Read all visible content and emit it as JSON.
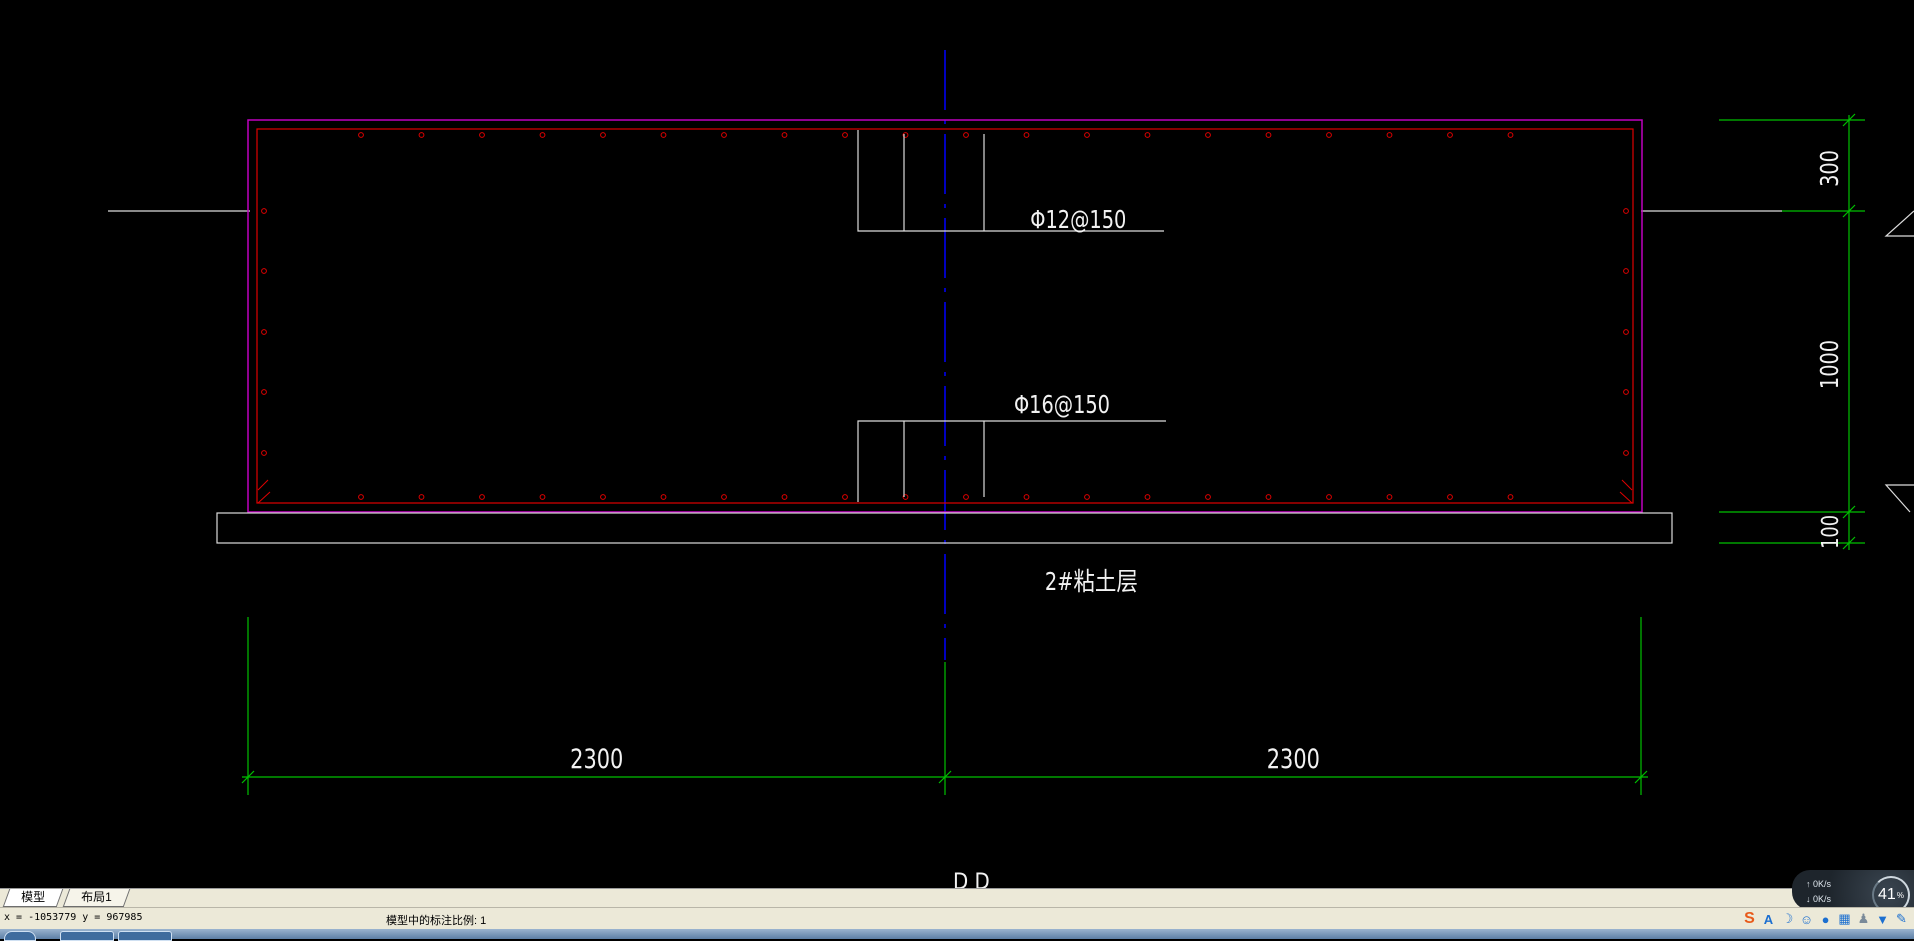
{
  "drawing": {
    "labels": {
      "top_rebar": "Φ12@150",
      "bottom_rebar": "Φ16@150",
      "layer": "2#粘土层",
      "dim_left": "2300",
      "dim_right": "2300",
      "dim_v_top": "300",
      "dim_v_mid": "1000",
      "dim_v_bottom": "100",
      "section_partial": "D   D"
    },
    "colors": {
      "background": "#000000",
      "outline": "#c000c0",
      "rebar": "#e00000",
      "dimension": "#00c000",
      "centerline": "#0000ff",
      "annotation": "#f2f2f2"
    }
  },
  "tabs": [
    {
      "label": "模型",
      "active": true
    },
    {
      "label": "布局1",
      "active": false
    }
  ],
  "status": {
    "coords": "x = -1053779 y = 967985",
    "annotation_scale": "模型中的标注比例: 1"
  },
  "net_meter": {
    "up": "0K/s",
    "down": "0K/s",
    "percent": "41",
    "percent_unit": "%"
  },
  "tray_icons": [
    "sogou-s-icon",
    "ime-a-icon",
    "moon-icon",
    "smiley-icon",
    "mic-icon",
    "keyboard-icon",
    "user-icon",
    "shirt-icon",
    "wrench-icon"
  ]
}
